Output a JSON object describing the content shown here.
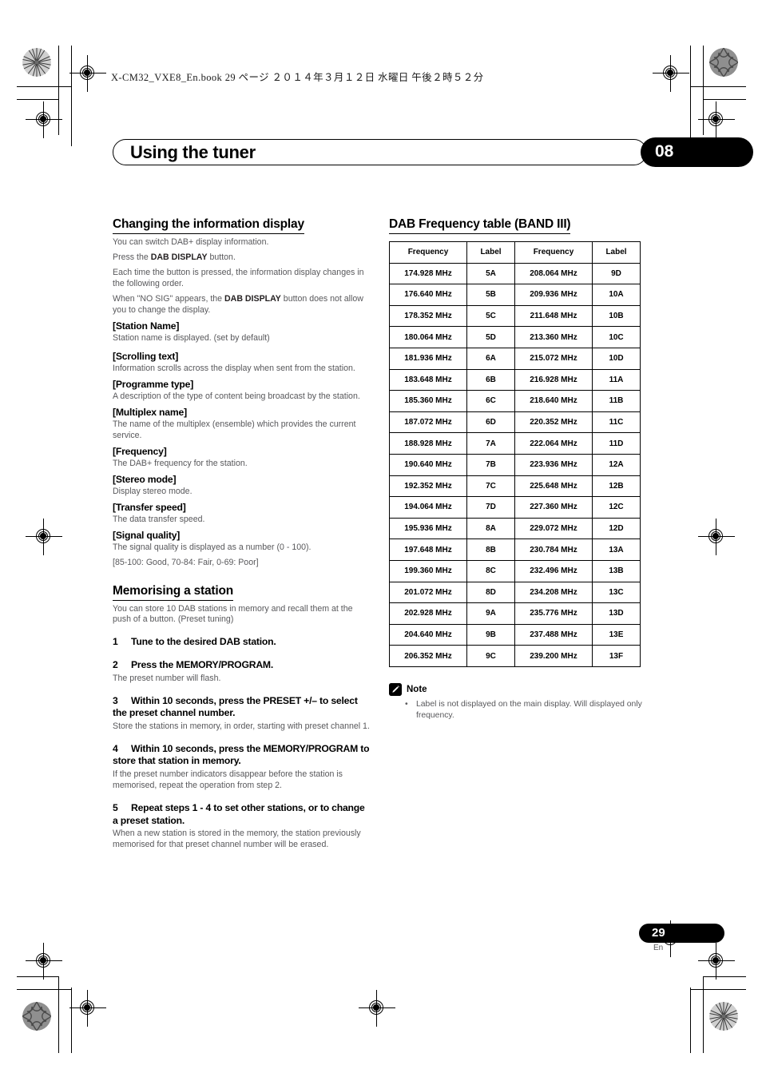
{
  "print_header": {
    "bookinfo": "X-CM32_VXE8_En.book   29 ページ   ２０１４年３月１２日   水曜日   午後２時５２分"
  },
  "chapter": {
    "title": "Using the tuner",
    "number": "08"
  },
  "left_column": {
    "section_title": "Changing the information display",
    "intro": [
      "You can switch DAB+ display information.",
      "Press the DAB DISPLAY button.",
      "Each time the button is pressed, the information display changes in the following order.",
      "When \"NO SIG\" appears, the DAB DISPLAY button does not allow you to change the display."
    ],
    "items": [
      {
        "heading": "[Station Name]",
        "text": "Station name is displayed. (set by default)"
      },
      {
        "heading": "[Scrolling text]",
        "text": "Information scrolls across the display when sent from the station."
      },
      {
        "heading": "[Programme type]",
        "text": "A description of the type of content being broadcast by the station."
      },
      {
        "heading": "[Multiplex name]",
        "text": "The name of the multiplex (ensemble) which provides the current service."
      },
      {
        "heading": "[Frequency]",
        "text": "The DAB+ frequency for the station."
      },
      {
        "heading": "[Stereo mode]",
        "text": "Display stereo mode."
      },
      {
        "heading": "[Transfer speed]",
        "text": "The data transfer speed."
      },
      {
        "heading": "[Signal quality]",
        "text": "The signal quality is displayed as a number (0 - 100)."
      }
    ],
    "signal_quality_ranges": "[85-100: Good, 70-84: Fair, 0-69: Poor]",
    "memorising_title": "Memorising a station",
    "memorising_intro": "You can store 10 DAB stations in memory and recall them at the push of a button. (Preset tuning)",
    "steps": [
      {
        "num": "1",
        "title": "Tune to the desired DAB station.",
        "body": ""
      },
      {
        "num": "2",
        "title": "Press the MEMORY/PROGRAM.",
        "body": "The preset number will flash."
      },
      {
        "num": "3",
        "title": "Within 10 seconds, press the PRESET +/– to select the preset channel number.",
        "body": "Store the stations in memory, in order, starting with preset channel 1."
      },
      {
        "num": "4",
        "title": "Within 10 seconds, press the MEMORY/PROGRAM to store that station in memory.",
        "body": "If the preset number indicators disappear before the station is memorised, repeat the operation from step 2."
      },
      {
        "num": "5",
        "title": "Repeat steps 1 - 4 to set other stations, or to change a preset station.",
        "body": "When a new station is stored in the memory, the station previously memorised for that preset channel number will be erased."
      }
    ]
  },
  "right_column": {
    "section_title": "DAB Frequency table (BAND III)",
    "table": {
      "headers": [
        "Frequency",
        "Label",
        "Frequency",
        "Label"
      ],
      "rows": [
        [
          "174.928 MHz",
          "5A",
          "208.064 MHz",
          "9D"
        ],
        [
          "176.640 MHz",
          "5B",
          "209.936 MHz",
          "10A"
        ],
        [
          "178.352 MHz",
          "5C",
          "211.648 MHz",
          "10B"
        ],
        [
          "180.064 MHz",
          "5D",
          "213.360 MHz",
          "10C"
        ],
        [
          "181.936 MHz",
          "6A",
          "215.072 MHz",
          "10D"
        ],
        [
          "183.648 MHz",
          "6B",
          "216.928 MHz",
          "11A"
        ],
        [
          "185.360 MHz",
          "6C",
          "218.640 MHz",
          "11B"
        ],
        [
          "187.072 MHz",
          "6D",
          "220.352 MHz",
          "11C"
        ],
        [
          "188.928 MHz",
          "7A",
          "222.064 MHz",
          "11D"
        ],
        [
          "190.640 MHz",
          "7B",
          "223.936 MHz",
          "12A"
        ],
        [
          "192.352 MHz",
          "7C",
          "225.648 MHz",
          "12B"
        ],
        [
          "194.064 MHz",
          "7D",
          "227.360 MHz",
          "12C"
        ],
        [
          "195.936 MHz",
          "8A",
          "229.072 MHz",
          "12D"
        ],
        [
          "197.648 MHz",
          "8B",
          "230.784 MHz",
          "13A"
        ],
        [
          "199.360 MHz",
          "8C",
          "232.496 MHz",
          "13B"
        ],
        [
          "201.072 MHz",
          "8D",
          "234.208 MHz",
          "13C"
        ],
        [
          "202.928 MHz",
          "9A",
          "235.776 MHz",
          "13D"
        ],
        [
          "204.640 MHz",
          "9B",
          "237.488 MHz",
          "13E"
        ],
        [
          "206.352 MHz",
          "9C",
          "239.200 MHz",
          "13F"
        ]
      ]
    },
    "note": {
      "icon": "pencil-icon",
      "title": "Note",
      "bullets": [
        "Label is not displayed on the main display. Will displayed only frequency."
      ]
    }
  },
  "footer": {
    "page_number": "29",
    "language": "En"
  }
}
